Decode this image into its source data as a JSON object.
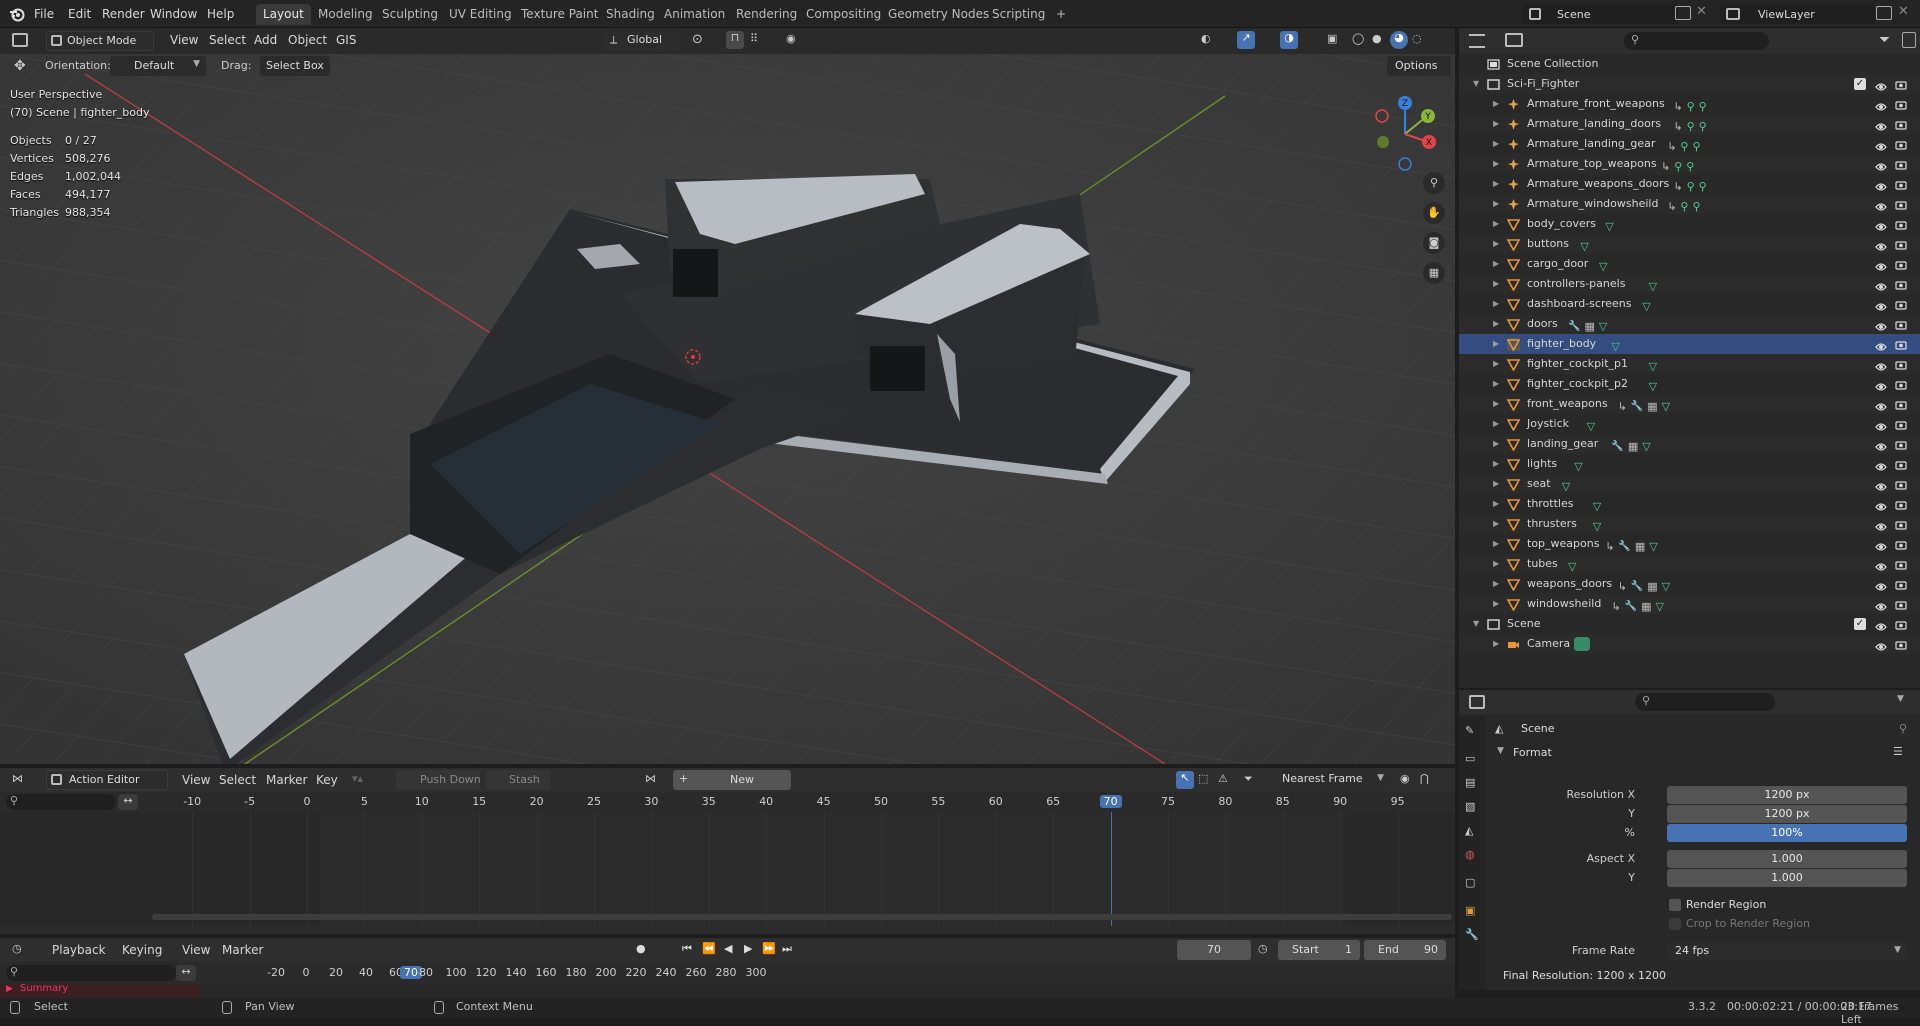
{
  "menubar": {
    "items": [
      "File",
      "Edit",
      "Render",
      "Window",
      "Help"
    ],
    "workspaces": [
      "Layout",
      "Modeling",
      "Sculpting",
      "UV Editing",
      "Texture Paint",
      "Shading",
      "Animation",
      "Rendering",
      "Compositing",
      "Geometry Nodes",
      "Scripting"
    ],
    "active_workspace": "Layout",
    "add_tab": "+",
    "scene_label": "Scene",
    "view_layer_label": "ViewLayer"
  },
  "viewport_header": {
    "mode": "Object Mode",
    "menus": [
      "View",
      "Select",
      "Add",
      "Object",
      "GIS"
    ],
    "transform_orientation": "Global",
    "orientation_label": "Orientation:",
    "orientation_value": "Default",
    "drag_label": "Drag:",
    "drag_value": "Select Box",
    "options_label": "Options"
  },
  "viewport": {
    "perspective": "User Perspective",
    "context": "(70) Scene | fighter_body",
    "stats": [
      {
        "label": "Objects",
        "value": "0 / 27"
      },
      {
        "label": "Vertices",
        "value": "508,276"
      },
      {
        "label": "Edges",
        "value": "1,002,044"
      },
      {
        "label": "Faces",
        "value": "494,177"
      },
      {
        "label": "Triangles",
        "value": "988,354"
      }
    ],
    "gizmo": {
      "x": "X",
      "y": "Y",
      "z": "Z"
    },
    "colors": {
      "background": "#3c3c3c",
      "x_axis": "#c03a3a",
      "y_axis": "#6f9a2a",
      "gizmo_x": "#e0454a",
      "gizmo_y": "#8ab63a",
      "gizmo_z": "#3a7fd8"
    }
  },
  "outliner": {
    "search_placeholder": "",
    "root": "Scene Collection",
    "collection": "Sci-Fi_Fighter",
    "items": [
      {
        "name": "Armature_front_weapons",
        "type": "armature",
        "mods": [
          "pose",
          "bone",
          "bone"
        ]
      },
      {
        "name": "Armature_landing_doors",
        "type": "armature",
        "mods": [
          "pose",
          "bone",
          "bone"
        ]
      },
      {
        "name": "Armature_landing_gear",
        "type": "armature",
        "mods": [
          "pose",
          "bone",
          "bone"
        ]
      },
      {
        "name": "Armature_top_weapons",
        "type": "armature",
        "mods": [
          "pose",
          "bone",
          "bone"
        ]
      },
      {
        "name": "Armature_weapons_doors",
        "type": "armature",
        "mods": [
          "pose",
          "bone",
          "bone"
        ]
      },
      {
        "name": "Armature_windowsheild",
        "type": "armature",
        "mods": [
          "pose",
          "bone",
          "bone"
        ]
      },
      {
        "name": "body_covers",
        "type": "mesh",
        "mods": [
          "mesh"
        ]
      },
      {
        "name": "buttons",
        "type": "mesh",
        "mods": [
          "mesh"
        ]
      },
      {
        "name": "cargo_door",
        "type": "mesh",
        "mods": [
          "mesh"
        ]
      },
      {
        "name": "controllers-panels",
        "type": "mesh",
        "mods": [
          "mesh"
        ]
      },
      {
        "name": "dashboard-screens",
        "type": "mesh",
        "mods": [
          "mesh"
        ]
      },
      {
        "name": "doors",
        "type": "mesh",
        "mods": [
          "wrench",
          "grid",
          "mesh"
        ]
      },
      {
        "name": "fighter_body",
        "type": "mesh",
        "mods": [
          "mesh"
        ],
        "selected": true
      },
      {
        "name": "fighter_cockpit_p1",
        "type": "mesh",
        "mods": [
          "mesh"
        ]
      },
      {
        "name": "fighter_cockpit_p2",
        "type": "mesh",
        "mods": [
          "mesh"
        ]
      },
      {
        "name": "front_weapons",
        "type": "mesh",
        "mods": [
          "pose",
          "wrench",
          "grid",
          "mesh"
        ]
      },
      {
        "name": "Joystick",
        "type": "mesh",
        "mods": [
          "mesh"
        ]
      },
      {
        "name": "landing_gear",
        "type": "mesh",
        "mods": [
          "wrench",
          "grid",
          "mesh"
        ]
      },
      {
        "name": "lights",
        "type": "mesh",
        "mods": [
          "mesh"
        ]
      },
      {
        "name": "seat",
        "type": "mesh",
        "mods": [
          "mesh"
        ]
      },
      {
        "name": "throttles",
        "type": "mesh",
        "mods": [
          "mesh"
        ]
      },
      {
        "name": "thrusters",
        "type": "mesh",
        "mods": [
          "mesh"
        ]
      },
      {
        "name": "top_weapons",
        "type": "mesh",
        "mods": [
          "pose",
          "wrench",
          "grid",
          "mesh"
        ]
      },
      {
        "name": "tubes",
        "type": "mesh",
        "mods": [
          "mesh"
        ]
      },
      {
        "name": "weapons_doors",
        "type": "mesh",
        "mods": [
          "pose",
          "wrench",
          "grid",
          "mesh"
        ]
      },
      {
        "name": "windowsheild",
        "type": "mesh",
        "mods": [
          "pose",
          "wrench",
          "grid",
          "mesh"
        ]
      }
    ],
    "scene_collection": "Scene",
    "camera": "Camera"
  },
  "properties": {
    "breadcrumb": "Scene",
    "panel_title": "Format",
    "resolution_x_label": "Resolution X",
    "resolution_x": "1200 px",
    "resolution_y_label": "Y",
    "resolution_y": "1200 px",
    "percent_label": "%",
    "percent": "100%",
    "percent_fraction": 1.0,
    "aspect_x_label": "Aspect X",
    "aspect_x": "1.000",
    "aspect_y_label": "Y",
    "aspect_y": "1.000",
    "render_region": "Render Region",
    "crop_region": "Crop to Render Region",
    "frame_rate_label": "Frame Rate",
    "frame_rate": "24 fps",
    "final_resolution": "Final Resolution: 1200 x 1200"
  },
  "action_editor": {
    "mode": "Action Editor",
    "menus": [
      "View",
      "Select",
      "Marker",
      "Key"
    ],
    "push_down": "Push Down",
    "stash": "Stash",
    "new_label": "New",
    "snap": "Nearest Frame",
    "ruler": [
      "-10",
      "-5",
      "0",
      "5",
      "10",
      "15",
      "20",
      "25",
      "30",
      "35",
      "40",
      "45",
      "50",
      "55",
      "60",
      "65",
      "70",
      "75",
      "80",
      "85",
      "90",
      "95"
    ],
    "current_frame": "70",
    "summary": "Summary"
  },
  "timeline": {
    "menus": [
      "Playback",
      "Keying",
      "View",
      "Marker"
    ],
    "current_frame": "70",
    "start_label": "Start",
    "start": "1",
    "end_label": "End",
    "end": "90",
    "ruler": [
      "-20",
      "0",
      "20",
      "40",
      "60",
      "70",
      "80",
      "100",
      "120",
      "140",
      "160",
      "180",
      "200",
      "220",
      "240",
      "260",
      "280",
      "300"
    ],
    "playhead": "70"
  },
  "statusbar": {
    "select": "Select",
    "pan": "Pan View",
    "context": "Context Menu",
    "version": "3.3.2",
    "timecode": "00:00:02:21 / 00:00:03:17",
    "frames_left": "20 Frames Left"
  },
  "accent": "#4772b3"
}
